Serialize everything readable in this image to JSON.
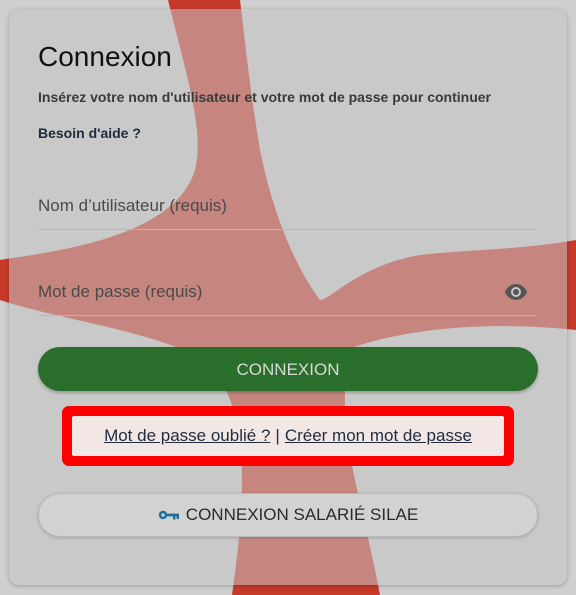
{
  "login": {
    "title": "Connexion",
    "subtitle": "Insérez votre nom d'utilisateur et votre mot de passe pour continuer",
    "help": "Besoin d'aide ?",
    "username_placeholder": "Nom d’utilisateur   (requis)",
    "password_placeholder": "Mot de passe (requis)",
    "submit": "CONNEXION",
    "forgot_password": "Mot de passe oublié ?",
    "separator": "|",
    "create_password": "Créer mon mot de passe",
    "silae_button": "CONNEXION SALARIÉ SILAE"
  },
  "colors": {
    "brand_red": "#c0301e",
    "button_green": "#2a6e2b",
    "key_icon": "#1f6f9a",
    "highlight_box": "#ff0000"
  },
  "icons": {
    "password_toggle": "eye-icon",
    "silae_button": "key-icon"
  }
}
